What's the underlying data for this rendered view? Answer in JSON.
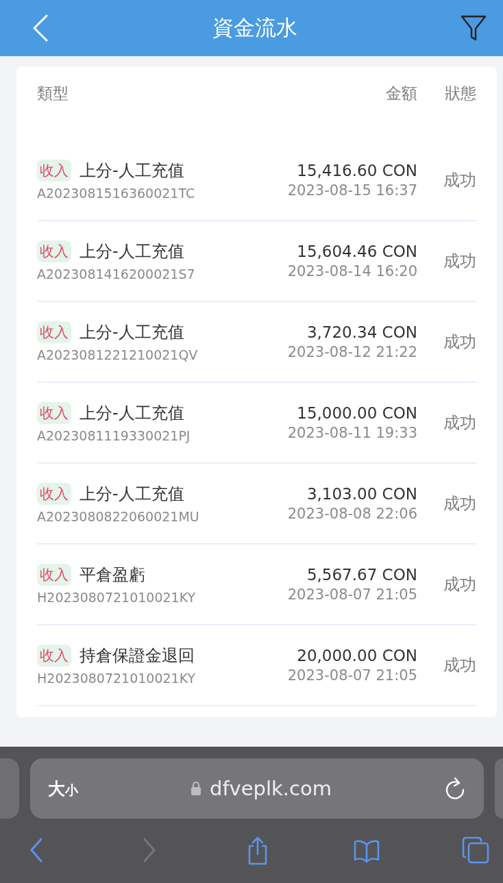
{
  "header": {
    "title": "資金流水"
  },
  "columns": [
    {
      "label": "類型"
    },
    {
      "label": "金額"
    },
    {
      "label": "狀態"
    }
  ],
  "rows": [
    {
      "tag": "收入",
      "type": "上分-人工充值",
      "id": "A2023081516360021TC",
      "amount": "15,416.60 CON",
      "time": "2023-08-15 16:37",
      "status": "成功"
    },
    {
      "tag": "收入",
      "type": "上分-人工充值",
      "id": "A2023081416200021S7",
      "amount": "15,604.46 CON",
      "time": "2023-08-14 16:20",
      "status": "成功"
    },
    {
      "tag": "收入",
      "type": "上分-人工充值",
      "id": "A2023081221210021QV",
      "amount": "3,720.34 CON",
      "time": "2023-08-12 21:22",
      "status": "成功"
    },
    {
      "tag": "收入",
      "type": "上分-人工充值",
      "id": "A2023081119330021PJ",
      "amount": "15,000.00 CON",
      "time": "2023-08-11 19:33",
      "status": "成功"
    },
    {
      "tag": "收入",
      "type": "上分-人工充值",
      "id": "A2023080822060021MU",
      "amount": "3,103.00 CON",
      "time": "2023-08-08 22:06",
      "status": "成功"
    },
    {
      "tag": "收入",
      "type": "平倉盈虧",
      "id": "H2023080721010021KY",
      "amount": "5,567.67 CON",
      "time": "2023-08-07 21:05",
      "status": "成功"
    },
    {
      "tag": "收入",
      "type": "持倉保證金退回",
      "id": "H2023080721010021KY",
      "amount": "20,000.00 CON",
      "time": "2023-08-07 21:05",
      "status": "成功"
    }
  ],
  "browser": {
    "text_size": {
      "large": "大",
      "small": "小"
    },
    "url": "dfveplk.com",
    "toolbar": [
      {
        "kind": "back",
        "disabled": false
      },
      {
        "kind": "forward",
        "disabled": true
      },
      {
        "kind": "share",
        "disabled": false
      },
      {
        "kind": "bookmarks",
        "disabled": false
      },
      {
        "kind": "tabs",
        "disabled": false
      }
    ]
  }
}
